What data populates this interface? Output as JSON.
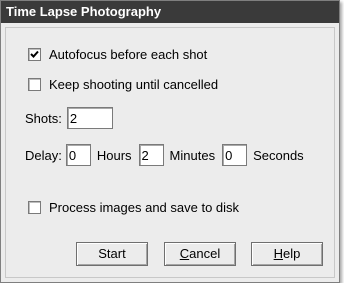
{
  "window": {
    "title": "Time Lapse Photography"
  },
  "options": {
    "autofocus": {
      "label": "Autofocus before each shot",
      "checked": true
    },
    "keep_shooting": {
      "label": "Keep shooting until cancelled",
      "checked": false
    },
    "process_images": {
      "label": "Process images and save to disk",
      "checked": false
    }
  },
  "shots": {
    "label": "Shots:",
    "value": "2"
  },
  "delay": {
    "label": "Delay:",
    "hours": {
      "value": "0",
      "unit": "Hours"
    },
    "minutes": {
      "value": "2",
      "unit": "Minutes"
    },
    "seconds": {
      "value": "0",
      "unit": "Seconds"
    }
  },
  "buttons": {
    "start": "Start",
    "cancel": {
      "mnemonic": "C",
      "rest": "ancel"
    },
    "help": {
      "mnemonic": "H",
      "rest": "elp"
    }
  },
  "icons": {
    "checkmark": "check-icon"
  }
}
